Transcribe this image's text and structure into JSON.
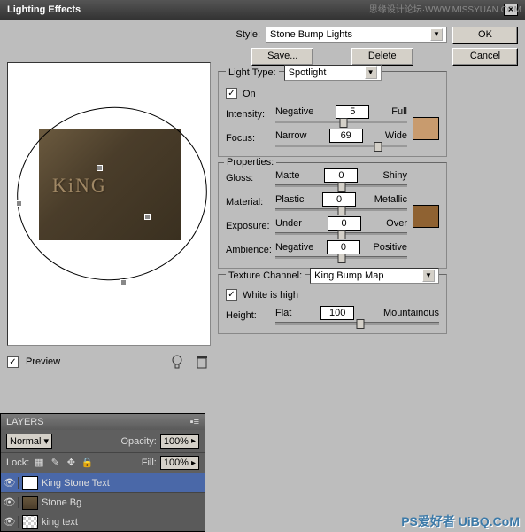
{
  "watermark_top": "思缘设计论坛·WWW.MISSYUAN.COM",
  "watermark_bottom": "PS爱好者 UiBQ.CoM",
  "title": "Lighting Effects",
  "buttons": {
    "ok": "OK",
    "cancel": "Cancel",
    "save": "Save...",
    "delete": "Delete"
  },
  "style": {
    "label": "Style:",
    "value": "Stone Bump Lights"
  },
  "preview": {
    "label": "Preview",
    "sample_text": "KiNG"
  },
  "light": {
    "legend": "Light Type:",
    "value": "Spotlight",
    "on_label": "On",
    "intensity": {
      "label": "Intensity:",
      "left": "Negative",
      "right": "Full",
      "value": "5",
      "pos": 52
    },
    "focus": {
      "label": "Focus:",
      "left": "Narrow",
      "right": "Wide",
      "value": "69",
      "pos": 78
    },
    "swatch": "#c89b6e"
  },
  "props": {
    "legend": "Properties:",
    "gloss": {
      "label": "Gloss:",
      "left": "Matte",
      "right": "Shiny",
      "value": "0",
      "pos": 50
    },
    "material": {
      "label": "Material:",
      "left": "Plastic",
      "right": "Metallic",
      "value": "0",
      "pos": 50
    },
    "exposure": {
      "label": "Exposure:",
      "left": "Under",
      "right": "Over",
      "value": "0",
      "pos": 50
    },
    "ambience": {
      "label": "Ambience:",
      "left": "Negative",
      "right": "Positive",
      "value": "0",
      "pos": 50
    },
    "swatch": "#8f6232"
  },
  "texture": {
    "legend": "Texture Channel:",
    "value": "King Bump Map",
    "white_label": "White is high",
    "height": {
      "label": "Height:",
      "left": "Flat",
      "right": "Mountainous",
      "value": "100",
      "pos": 52
    }
  },
  "layers": {
    "title": "LAYERS",
    "blend": "Normal",
    "opacity_label": "Opacity:",
    "opacity": "100%",
    "lock_label": "Lock:",
    "fill_label": "Fill:",
    "fill": "100%",
    "items": [
      {
        "name": "King Stone Text",
        "sel": true
      },
      {
        "name": "Stone Bg",
        "sel": false
      },
      {
        "name": "king text",
        "sel": false
      }
    ]
  }
}
